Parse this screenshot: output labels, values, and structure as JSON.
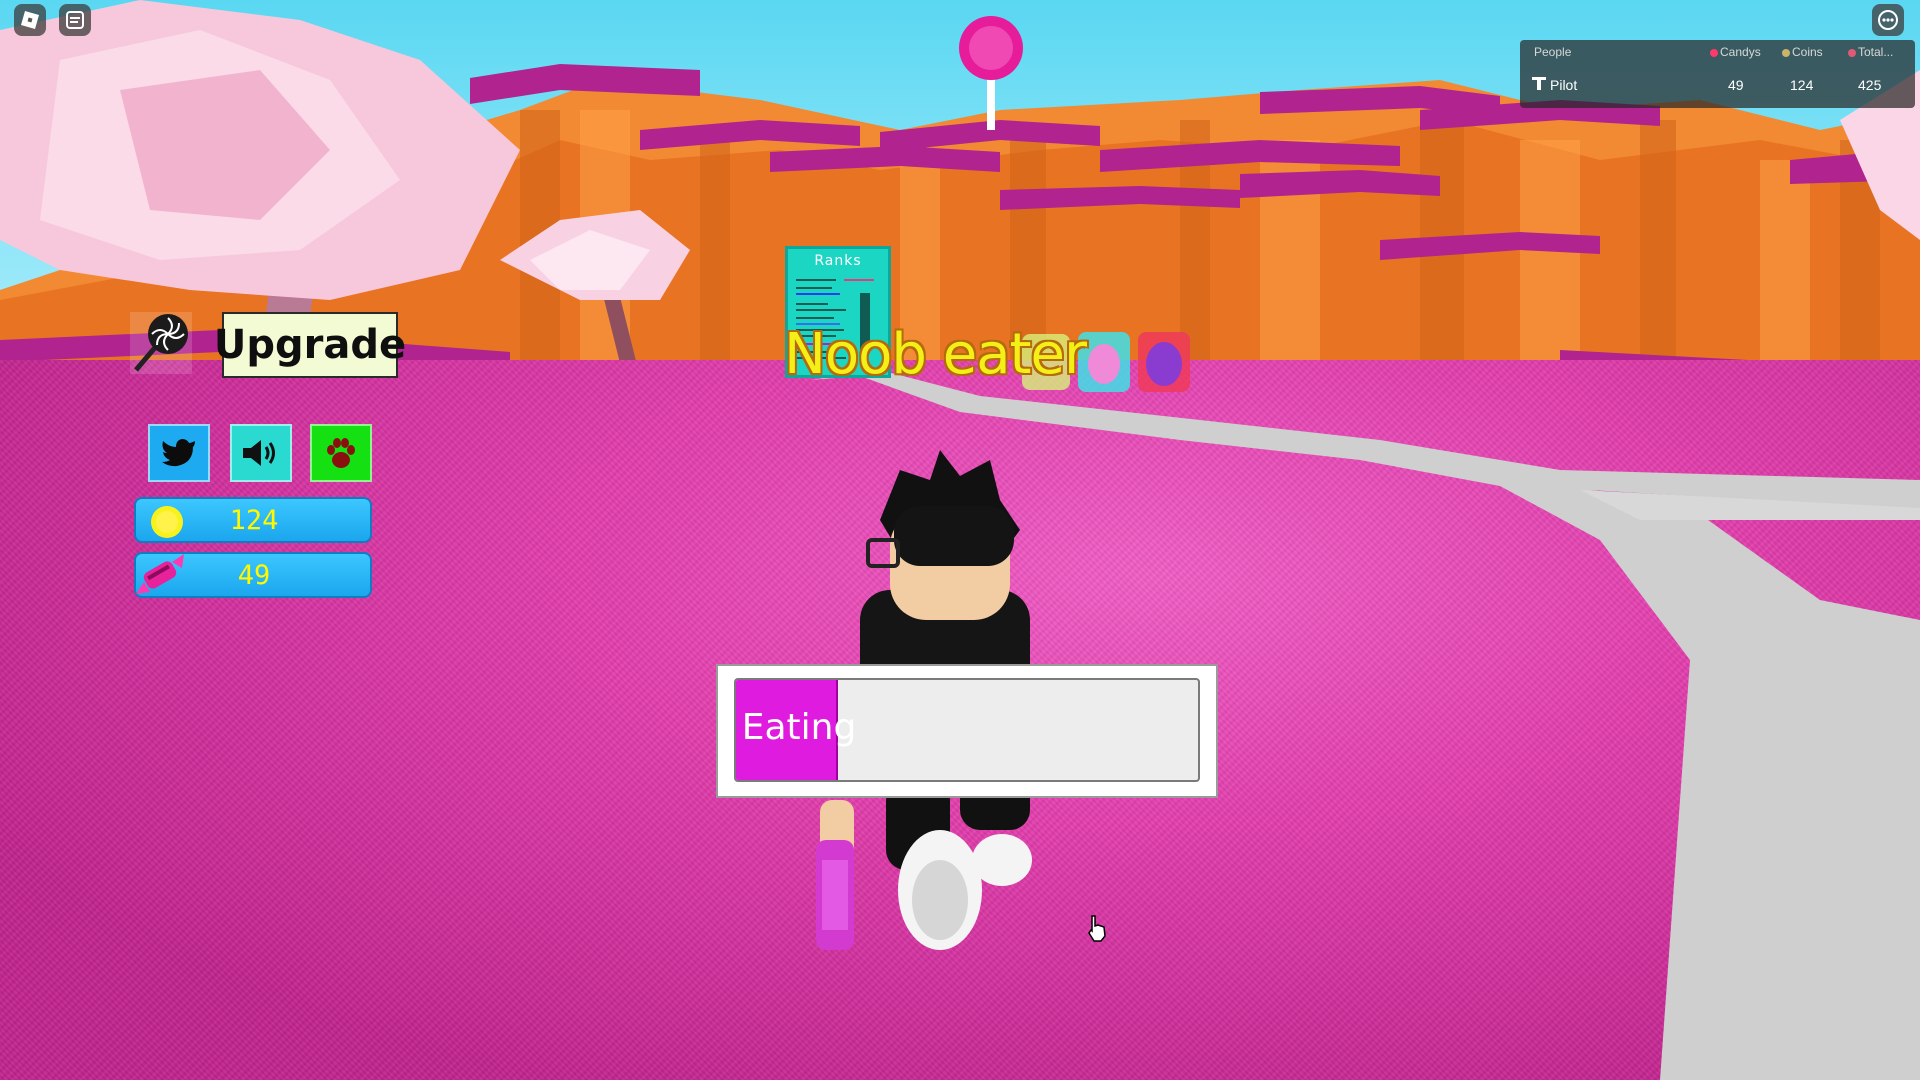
{
  "topbar": {
    "roblox_menu_icon": "roblox-logo-icon",
    "chat_icon": "chat-icon",
    "more_icon": "more-options-icon"
  },
  "leaderboard": {
    "header": {
      "people": "People",
      "candys": "Candys",
      "coins": "Coins",
      "total": "Total..."
    },
    "rows": [
      {
        "name": "Pilot",
        "candys": "49",
        "coins": "124",
        "total": "425"
      }
    ]
  },
  "hud": {
    "upgrade_label": "Upgrade",
    "upgrade_icon": "lollipop-icon",
    "buttons": [
      {
        "name": "twitter",
        "icon": "twitter-bird-icon",
        "color": "#1eaaf0"
      },
      {
        "name": "sound",
        "icon": "speaker-icon",
        "color": "#2ad9d0"
      },
      {
        "name": "pets",
        "icon": "paw-icon",
        "color": "#14e012"
      }
    ],
    "coins": {
      "value": "124",
      "icon": "coin-icon"
    },
    "candy": {
      "value": "49",
      "icon": "candy-icon"
    }
  },
  "world": {
    "sign_title": "Ranks",
    "floating_label": "Noob eater"
  },
  "eating": {
    "label": "Eating",
    "progress": 0.22,
    "fill_color": "#e01be0"
  },
  "colors": {
    "ground": "#e43fae",
    "sky": "#5ad7f2",
    "cliff": "#f07a2c",
    "cliff_top": "#b1238f",
    "path": "#cfcfcf"
  }
}
